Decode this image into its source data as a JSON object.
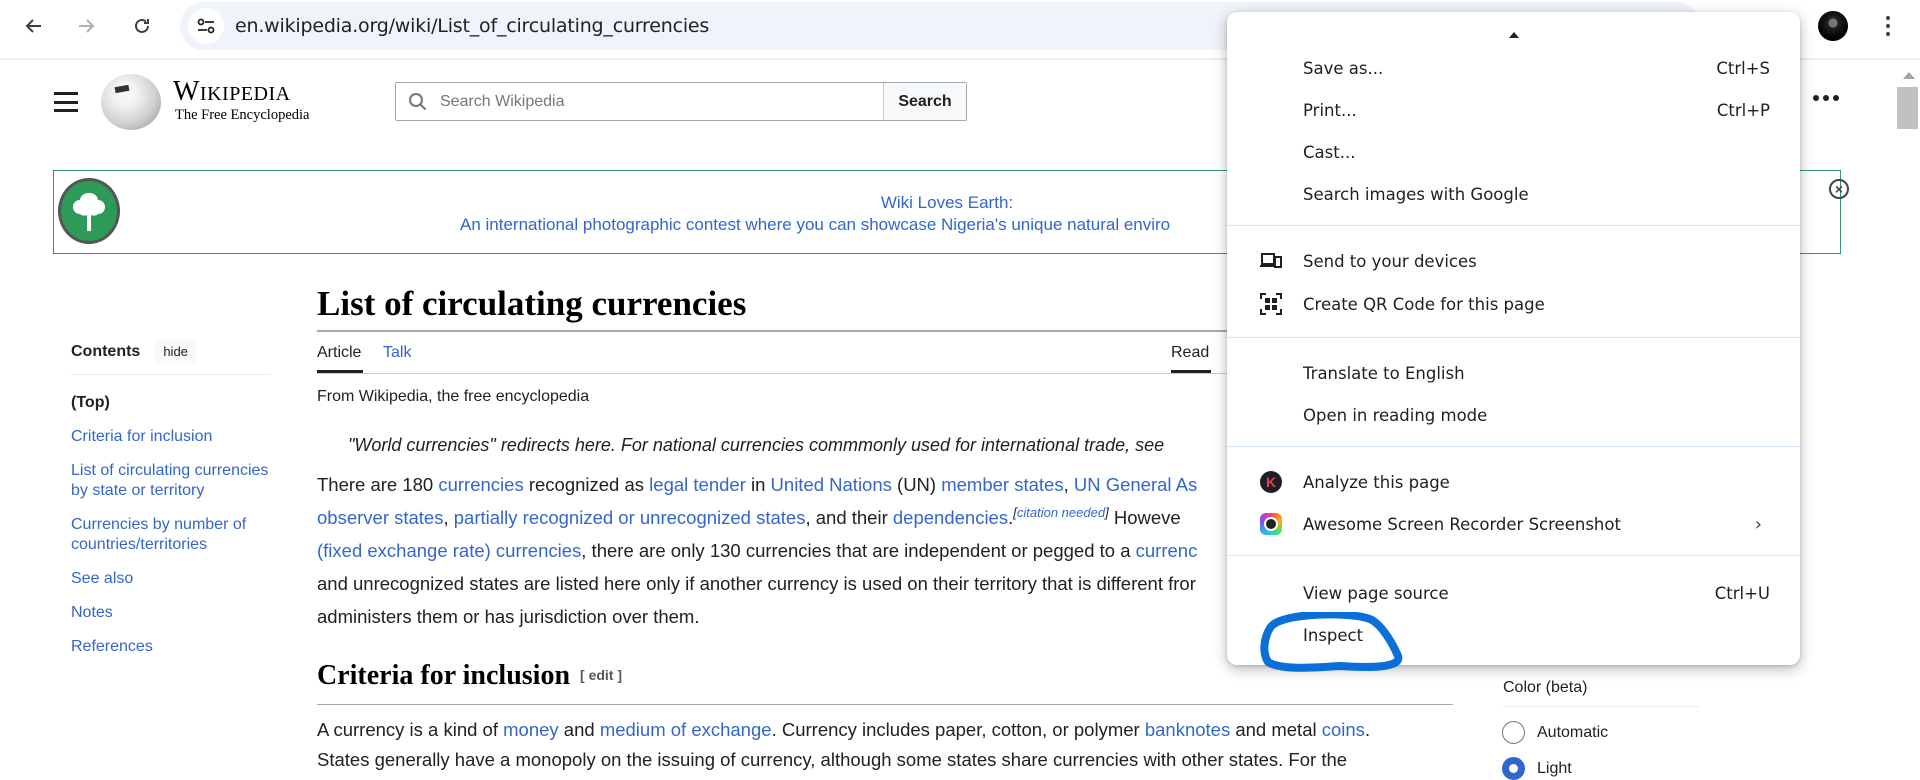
{
  "browser": {
    "url": "en.wikipedia.org/wiki/List_of_circulating_currencies",
    "icons": {
      "back": "arrow-left",
      "forward": "arrow-right",
      "reload": "reload",
      "site_info": "tune",
      "profile": "avatar",
      "menu": "kebab-vertical"
    }
  },
  "header": {
    "wordmark": "Wikipedia",
    "tagline": "The Free Encyclopedia",
    "search_placeholder": "Search Wikipedia",
    "search_button": "Search"
  },
  "banner": {
    "title": "Wiki Loves Earth:",
    "text": "An international photographic contest where you can showcase Nigeria's unique natural enviro"
  },
  "toc": {
    "title": "Contents",
    "hide": "hide",
    "items": [
      "(Top)",
      "Criteria for inclusion",
      "List of circulating currencies by state or territory",
      "Currencies by number of countries/territories",
      "See also",
      "Notes",
      "References"
    ]
  },
  "article": {
    "title": "List of circulating currencies",
    "tabs": {
      "article": "Article",
      "talk": "Talk",
      "read": "Read"
    },
    "from": "From Wikipedia, the free encyclopedia",
    "hatnote": "\"World currencies\" redirects here. For national currencies commmonly used for international trade, see",
    "intro": {
      "l1": [
        "There are 180 ",
        "currencies",
        " recognized as ",
        "legal tender",
        " in ",
        "United Nations",
        " (UN) ",
        "member states",
        ", ",
        "UN General As"
      ],
      "l2": [
        "observer states",
        ", ",
        "partially recognized or unrecognized states",
        ", and their ",
        "dependencies",
        ".",
        "citation needed",
        " Howeve"
      ],
      "l3": [
        "(fixed exchange rate) currencies",
        ", there are only 130 currencies that are independent or pegged to a ",
        "currenc"
      ],
      "l4": "and unrecognized states are listed here only if another currency is used on their territory that is different fror",
      "l5": "administers them or has jurisdiction over them."
    },
    "section_heading": "Criteria for inclusion",
    "edit_label": "[ edit ]",
    "section": {
      "l1": [
        "A currency is a kind of ",
        "money",
        " and ",
        "medium of exchange",
        ". Currency includes paper, cotton, or polymer ",
        "banknotes",
        " and metal ",
        "coins",
        "."
      ],
      "l2": "States generally have a monopoly on the issuing of currency, although some states share currencies with other states. For the"
    }
  },
  "appearance": {
    "color_label": "Color (beta)",
    "options": [
      "Automatic",
      "Light"
    ],
    "selected": "Light"
  },
  "context_menu": {
    "items": [
      {
        "label": "Save as...",
        "shortcut": "Ctrl+S"
      },
      {
        "label": "Print...",
        "shortcut": "Ctrl+P"
      },
      {
        "label": "Cast..."
      },
      {
        "label": "Search images with Google"
      },
      {
        "label": "Send to your devices",
        "icon": "devices-icon"
      },
      {
        "label": "Create QR Code for this page",
        "icon": "qr-code-icon"
      },
      {
        "label": "Translate to English"
      },
      {
        "label": "Open in reading mode"
      },
      {
        "label": "Analyze this page",
        "icon": "k-extension-icon"
      },
      {
        "label": "Awesome Screen Recorder  Screenshot",
        "icon": "screen-recorder-icon",
        "submenu": true
      },
      {
        "label": "View page source",
        "shortcut": "Ctrl+U"
      },
      {
        "label": "Inspect",
        "highlighted": true
      }
    ],
    "annotation_color": "#0a6fd6"
  }
}
